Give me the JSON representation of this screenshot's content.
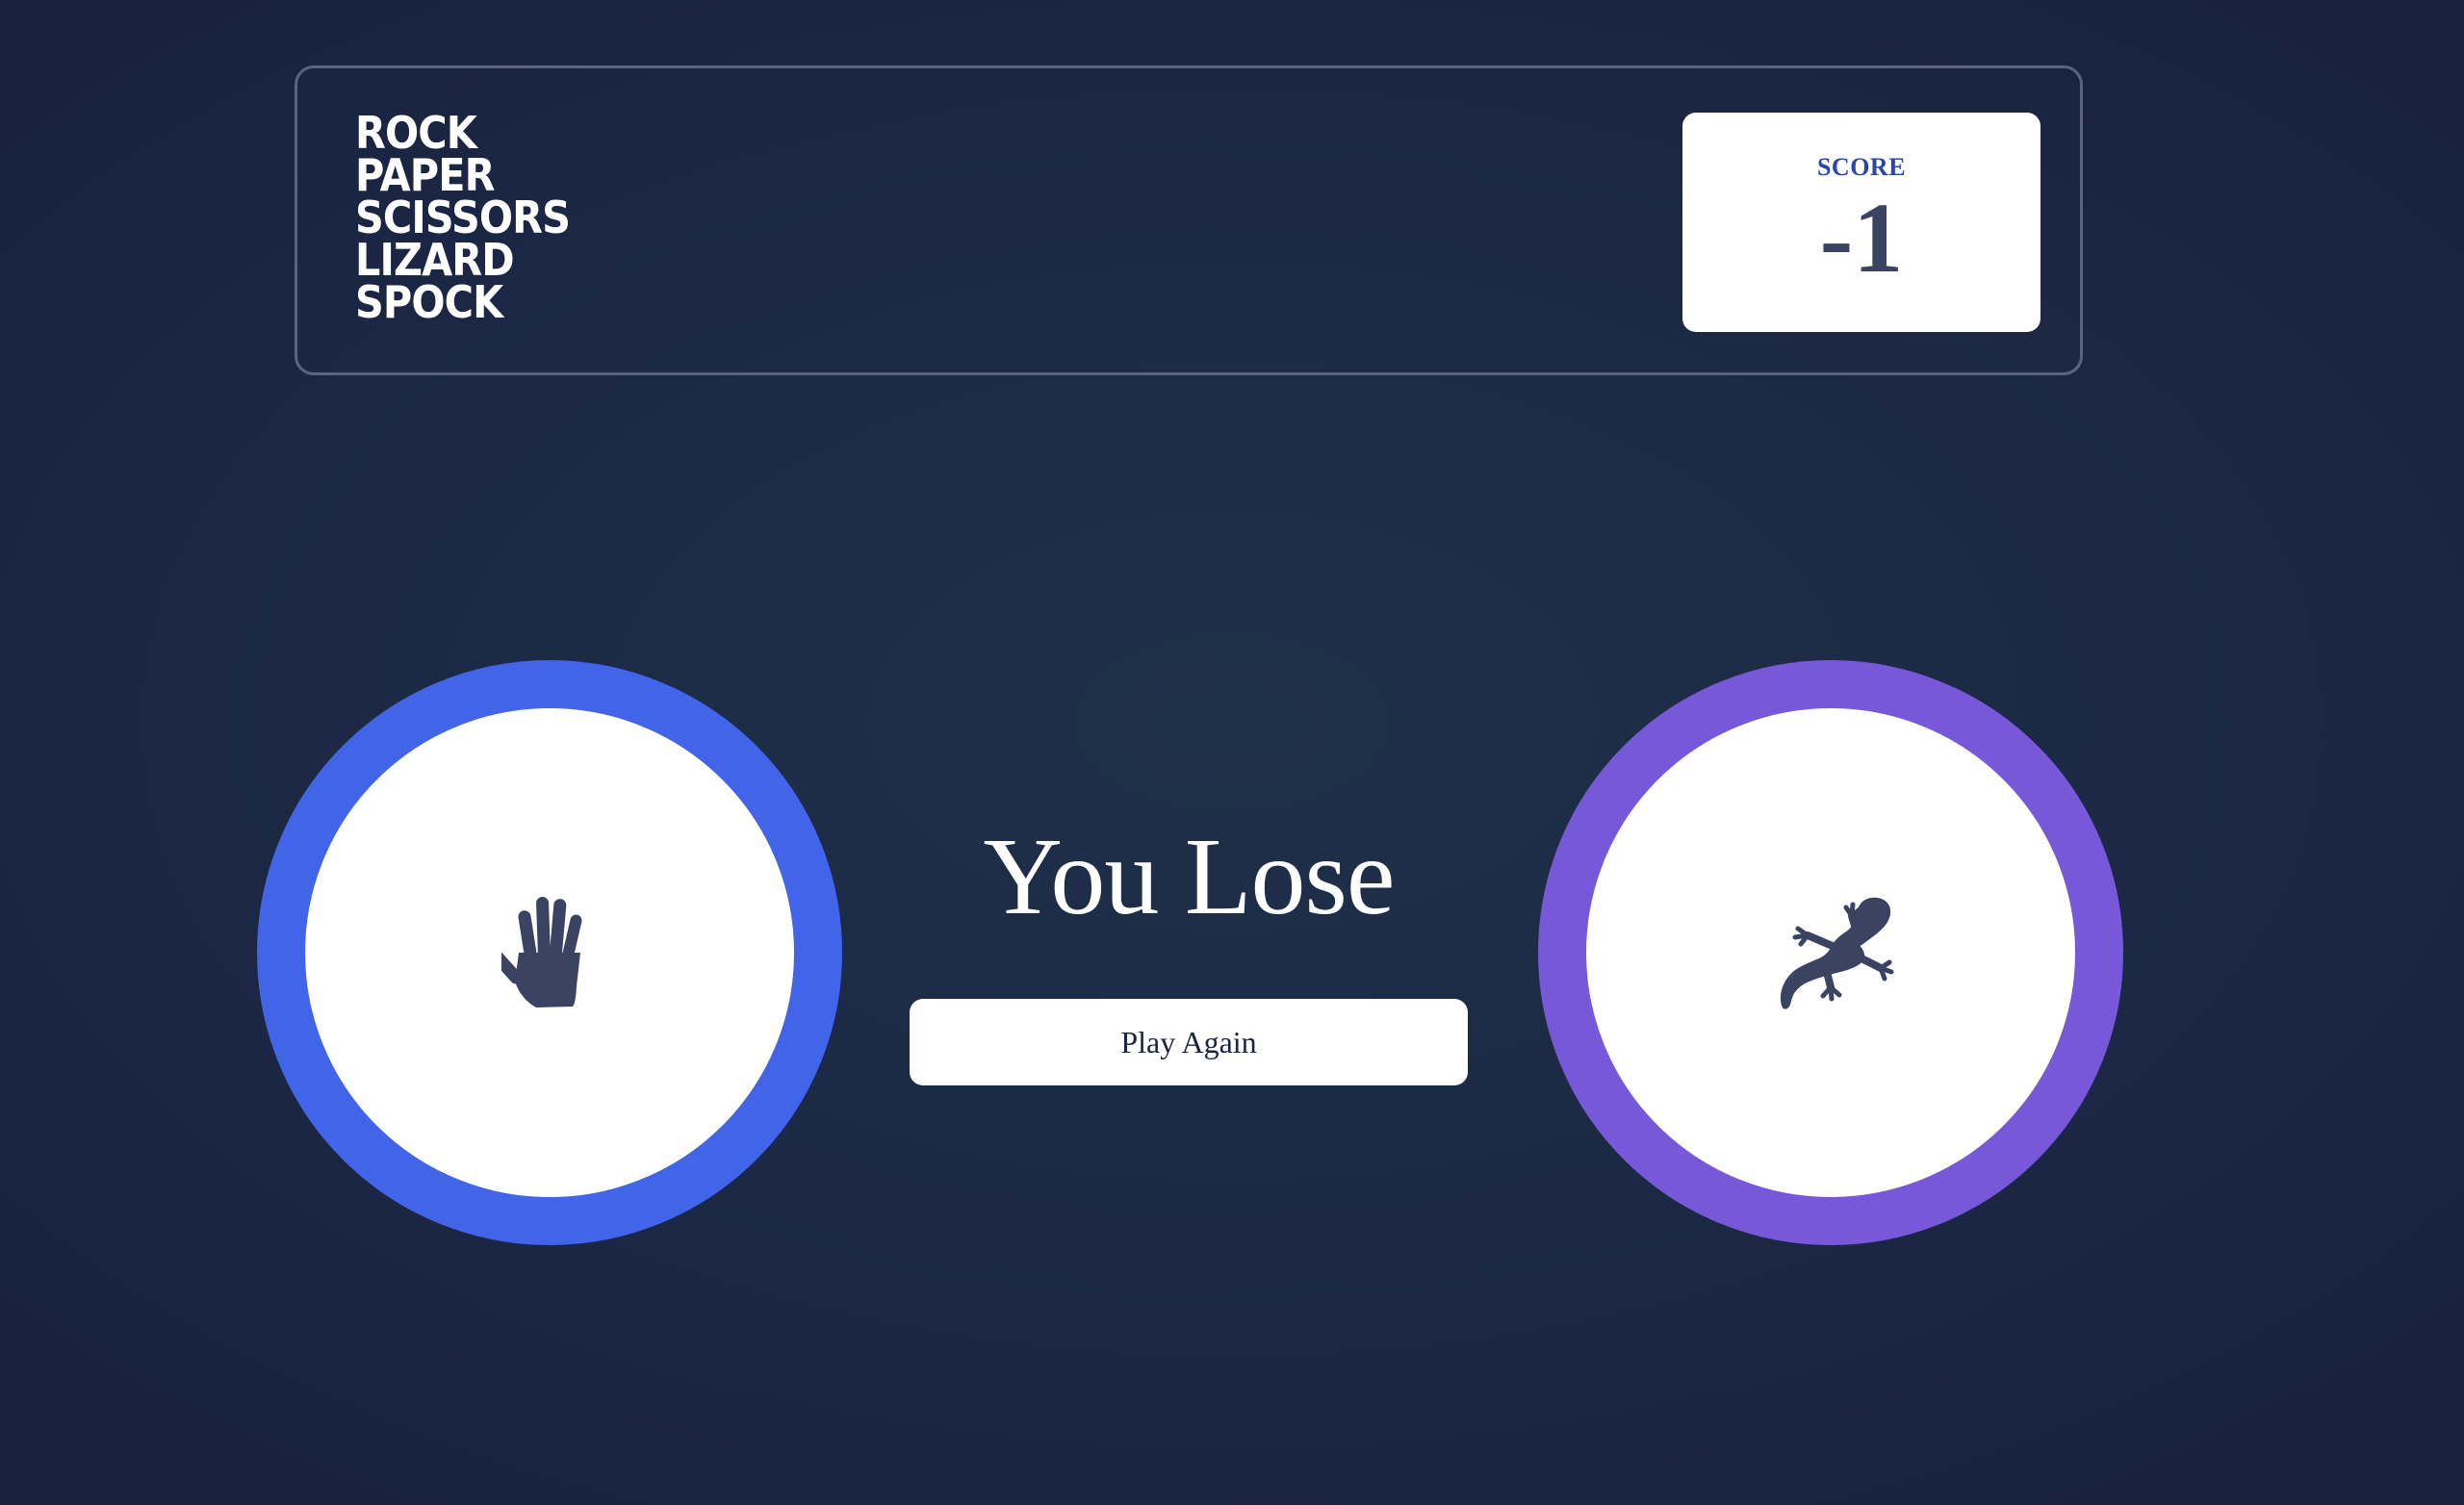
{
  "logo": {
    "lines": [
      "ROCK",
      "PAPER",
      "SCISSORS",
      "LIZARD",
      "SPOCK"
    ]
  },
  "score": {
    "label": "SCORE",
    "value": "-1"
  },
  "player_pick": {
    "choice": "paper",
    "icon": "paper-hand-icon",
    "ring_color": "#4264e8"
  },
  "house_pick": {
    "choice": "lizard",
    "icon": "lizard-icon",
    "ring_color": "#7758d8"
  },
  "result": {
    "text": "You Lose"
  },
  "play_again": {
    "label": "Play Again"
  },
  "colors": {
    "background": "#1b2744",
    "icon": "#3b4363",
    "score_label": "#2a46ad"
  }
}
